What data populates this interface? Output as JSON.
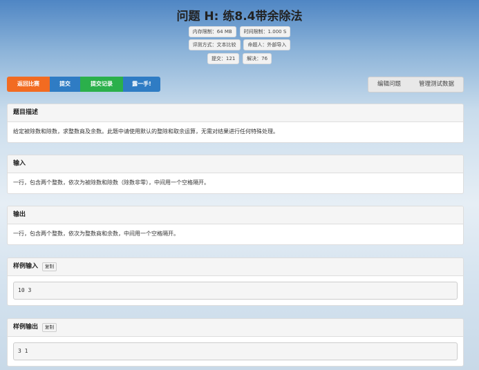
{
  "title": "问题 H: 练8.4带余除法",
  "meta": {
    "memory": "内存限制：64 MB",
    "time": "时间限制：1.000 S",
    "judge": "评测方式：文本比较",
    "author": "命题人：外部导入",
    "submits": "提交：121",
    "solved": "解决：76"
  },
  "toolbar": {
    "back": "返回比赛",
    "submit": "提交",
    "records": "提交记录",
    "try": "露一手!",
    "edit": "编辑问题",
    "manage": "管理测试数据"
  },
  "sections": {
    "desc": {
      "header": "题目描述",
      "body": "给定被除数和除数，求整数商及余数。此题中请使用默认的整除和取余运算，无需对结果进行任何特殊处理。"
    },
    "input": {
      "header": "输入",
      "body": "一行，包含两个整数，依次为被除数和除数（除数非零），中间用一个空格隔开。"
    },
    "output": {
      "header": "输出",
      "body": "一行，包含两个整数，依次为整数商和余数，中间用一个空格隔开。"
    },
    "sample_in": {
      "header": "样例输入",
      "copy": "复制",
      "code": "10 3"
    },
    "sample_out": {
      "header": "样例输出",
      "copy": "复制",
      "code": "3 1"
    }
  }
}
